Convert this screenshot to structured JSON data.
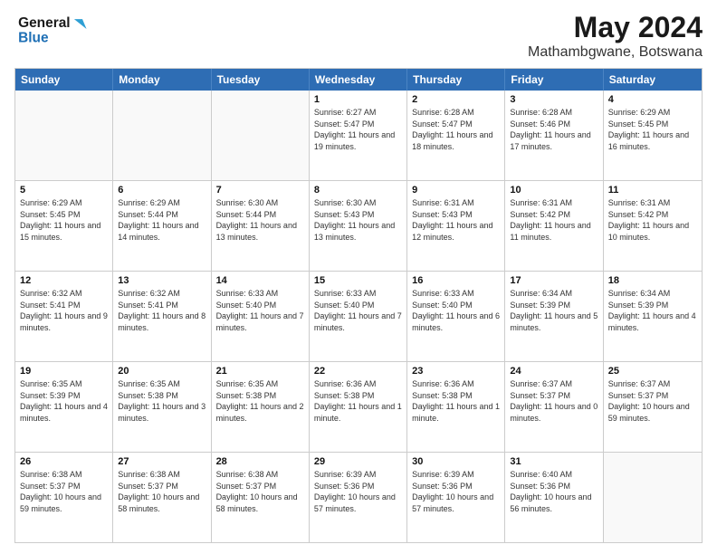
{
  "header": {
    "logo_line1": "General",
    "logo_line2": "Blue",
    "month": "May 2024",
    "location": "Mathambgwane, Botswana"
  },
  "days_of_week": [
    "Sunday",
    "Monday",
    "Tuesday",
    "Wednesday",
    "Thursday",
    "Friday",
    "Saturday"
  ],
  "weeks": [
    [
      {
        "day": "",
        "info": ""
      },
      {
        "day": "",
        "info": ""
      },
      {
        "day": "",
        "info": ""
      },
      {
        "day": "1",
        "info": "Sunrise: 6:27 AM\nSunset: 5:47 PM\nDaylight: 11 hours and 19 minutes."
      },
      {
        "day": "2",
        "info": "Sunrise: 6:28 AM\nSunset: 5:47 PM\nDaylight: 11 hours and 18 minutes."
      },
      {
        "day": "3",
        "info": "Sunrise: 6:28 AM\nSunset: 5:46 PM\nDaylight: 11 hours and 17 minutes."
      },
      {
        "day": "4",
        "info": "Sunrise: 6:29 AM\nSunset: 5:45 PM\nDaylight: 11 hours and 16 minutes."
      }
    ],
    [
      {
        "day": "5",
        "info": "Sunrise: 6:29 AM\nSunset: 5:45 PM\nDaylight: 11 hours and 15 minutes."
      },
      {
        "day": "6",
        "info": "Sunrise: 6:29 AM\nSunset: 5:44 PM\nDaylight: 11 hours and 14 minutes."
      },
      {
        "day": "7",
        "info": "Sunrise: 6:30 AM\nSunset: 5:44 PM\nDaylight: 11 hours and 13 minutes."
      },
      {
        "day": "8",
        "info": "Sunrise: 6:30 AM\nSunset: 5:43 PM\nDaylight: 11 hours and 13 minutes."
      },
      {
        "day": "9",
        "info": "Sunrise: 6:31 AM\nSunset: 5:43 PM\nDaylight: 11 hours and 12 minutes."
      },
      {
        "day": "10",
        "info": "Sunrise: 6:31 AM\nSunset: 5:42 PM\nDaylight: 11 hours and 11 minutes."
      },
      {
        "day": "11",
        "info": "Sunrise: 6:31 AM\nSunset: 5:42 PM\nDaylight: 11 hours and 10 minutes."
      }
    ],
    [
      {
        "day": "12",
        "info": "Sunrise: 6:32 AM\nSunset: 5:41 PM\nDaylight: 11 hours and 9 minutes."
      },
      {
        "day": "13",
        "info": "Sunrise: 6:32 AM\nSunset: 5:41 PM\nDaylight: 11 hours and 8 minutes."
      },
      {
        "day": "14",
        "info": "Sunrise: 6:33 AM\nSunset: 5:40 PM\nDaylight: 11 hours and 7 minutes."
      },
      {
        "day": "15",
        "info": "Sunrise: 6:33 AM\nSunset: 5:40 PM\nDaylight: 11 hours and 7 minutes."
      },
      {
        "day": "16",
        "info": "Sunrise: 6:33 AM\nSunset: 5:40 PM\nDaylight: 11 hours and 6 minutes."
      },
      {
        "day": "17",
        "info": "Sunrise: 6:34 AM\nSunset: 5:39 PM\nDaylight: 11 hours and 5 minutes."
      },
      {
        "day": "18",
        "info": "Sunrise: 6:34 AM\nSunset: 5:39 PM\nDaylight: 11 hours and 4 minutes."
      }
    ],
    [
      {
        "day": "19",
        "info": "Sunrise: 6:35 AM\nSunset: 5:39 PM\nDaylight: 11 hours and 4 minutes."
      },
      {
        "day": "20",
        "info": "Sunrise: 6:35 AM\nSunset: 5:38 PM\nDaylight: 11 hours and 3 minutes."
      },
      {
        "day": "21",
        "info": "Sunrise: 6:35 AM\nSunset: 5:38 PM\nDaylight: 11 hours and 2 minutes."
      },
      {
        "day": "22",
        "info": "Sunrise: 6:36 AM\nSunset: 5:38 PM\nDaylight: 11 hours and 1 minute."
      },
      {
        "day": "23",
        "info": "Sunrise: 6:36 AM\nSunset: 5:38 PM\nDaylight: 11 hours and 1 minute."
      },
      {
        "day": "24",
        "info": "Sunrise: 6:37 AM\nSunset: 5:37 PM\nDaylight: 11 hours and 0 minutes."
      },
      {
        "day": "25",
        "info": "Sunrise: 6:37 AM\nSunset: 5:37 PM\nDaylight: 10 hours and 59 minutes."
      }
    ],
    [
      {
        "day": "26",
        "info": "Sunrise: 6:38 AM\nSunset: 5:37 PM\nDaylight: 10 hours and 59 minutes."
      },
      {
        "day": "27",
        "info": "Sunrise: 6:38 AM\nSunset: 5:37 PM\nDaylight: 10 hours and 58 minutes."
      },
      {
        "day": "28",
        "info": "Sunrise: 6:38 AM\nSunset: 5:37 PM\nDaylight: 10 hours and 58 minutes."
      },
      {
        "day": "29",
        "info": "Sunrise: 6:39 AM\nSunset: 5:36 PM\nDaylight: 10 hours and 57 minutes."
      },
      {
        "day": "30",
        "info": "Sunrise: 6:39 AM\nSunset: 5:36 PM\nDaylight: 10 hours and 57 minutes."
      },
      {
        "day": "31",
        "info": "Sunrise: 6:40 AM\nSunset: 5:36 PM\nDaylight: 10 hours and 56 minutes."
      },
      {
        "day": "",
        "info": ""
      }
    ]
  ]
}
